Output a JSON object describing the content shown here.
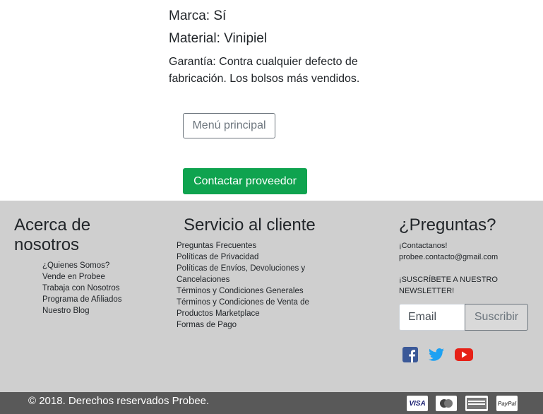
{
  "product": {
    "brand": "Marca: Sí",
    "material": "Material: Vinipiel",
    "description": "Garantía: Contra cualquier defecto de fabricación. Los bolsos más vendidos."
  },
  "buttons": {
    "main_menu": "Menú principal",
    "contact_supplier": "Contactar proveedor"
  },
  "footer": {
    "about": {
      "title_line1": "Acerca de",
      "title_line2": "nosotros",
      "links": [
        "¿Quienes Somos?",
        "Vende en Probee",
        "Trabaja con Nosotros",
        "Programa de Afiliados",
        "Nuestro Blog"
      ]
    },
    "service": {
      "title": "Servicio al cliente",
      "links": [
        "Preguntas Frecuentes",
        "Políticas de Privacidad",
        "Políticas de Envíos, Devoluciones y",
        "Cancelaciones",
        "Términos y Condiciones Generales",
        "Términos y Condiciones de Venta de",
        "Productos Marketplace",
        "Formas de Pago"
      ]
    },
    "questions": {
      "title": "¿Preguntas?",
      "contact_label": "¡Contactanos!",
      "email": "probee.contacto@gmail.com",
      "newsletter_line1": "¡SUSCRÍBETE A NUESTRO",
      "newsletter_line2": "NEWSLETTER!",
      "email_placeholder": "Email",
      "subscribe_label": "Suscribir"
    },
    "social_icons": [
      "facebook-icon",
      "twitter-icon",
      "youtube-icon"
    ]
  },
  "bottom_bar": {
    "copyright": "© 2018. Derechos reservados Probee.",
    "payment_methods": [
      "VISA",
      "MasterCard",
      "AMERICAN EXPRESS",
      "PayPal"
    ]
  },
  "colors": {
    "contact_button": "#0fa34f",
    "footer_bg": "#cfcfcf",
    "bottom_bg": "#595959",
    "facebook": "#3b5998",
    "twitter": "#1da1f2",
    "youtube": "#e62117"
  }
}
